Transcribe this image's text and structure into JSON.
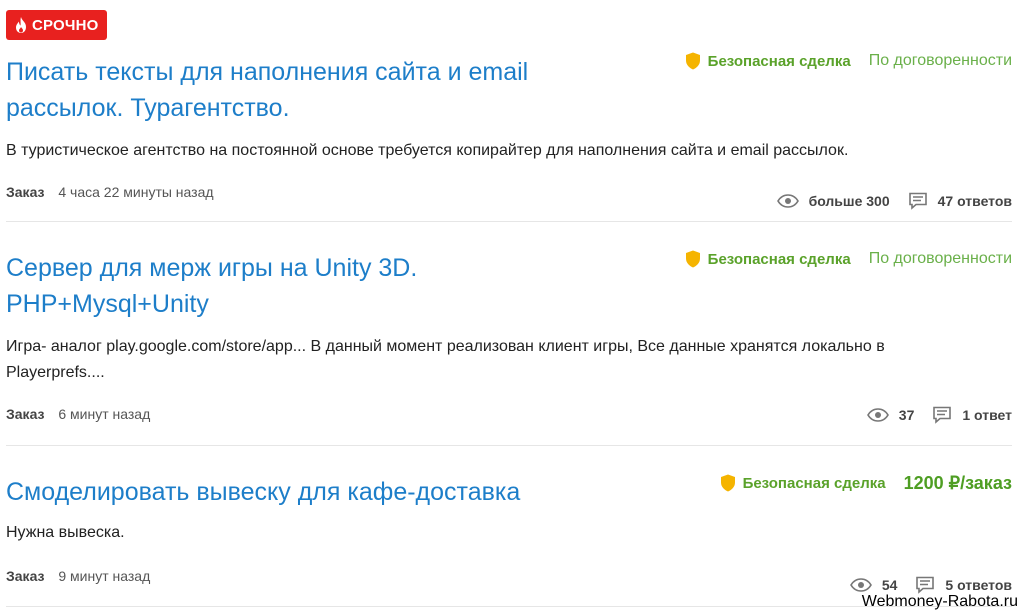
{
  "badge": {
    "label": "СРОЧНО"
  },
  "tasks": [
    {
      "title_line1": "Писать тексты для наполнения сайта и email",
      "title_line2": "рассылок. Турагентство.",
      "safe_deal": "Безопасная сделка",
      "price": "По договоренности",
      "description": "В туристическое агентство на постоянной основе требуется копирайтер для наполнения сайта и email рассылок.",
      "type": "Заказ",
      "time": "4 часа 22 минуты назад",
      "views": "больше 300",
      "replies": "47 ответов"
    },
    {
      "title_line1": "Сервер для мерж игры на Unity 3D.",
      "title_line2": "PHP+Mysql+Unity",
      "safe_deal": "Безопасная сделка",
      "price": "По договоренности",
      "description_line1": "Игра- аналог play.google.com/store/app... В данный момент реализован клиент игры, Все данные хранятся локально в",
      "description_line2": "Playerprefs....",
      "type": "Заказ",
      "time": "6 минут назад",
      "views": "37",
      "replies": "1 ответ"
    },
    {
      "title_line1": "Смоделировать вывеску для кафе-доставка",
      "safe_deal": "Безопасная сделка",
      "price": "1200 ₽/заказ",
      "description": "Нужна вывеска.",
      "type": "Заказ",
      "time": "9 минут назад",
      "views": "54",
      "replies": "5 ответов"
    }
  ],
  "watermark": "Webmoney-Rabota.ru",
  "colors": {
    "badge_bg": "#e8211f",
    "title_link": "#1d7ec9",
    "safe_deal": "#5aa22a",
    "shield": "#f5b400"
  },
  "icons": {
    "badge": "fire-icon",
    "safe_deal": "shield-icon",
    "views": "eye-icon",
    "replies": "comment-icon"
  }
}
